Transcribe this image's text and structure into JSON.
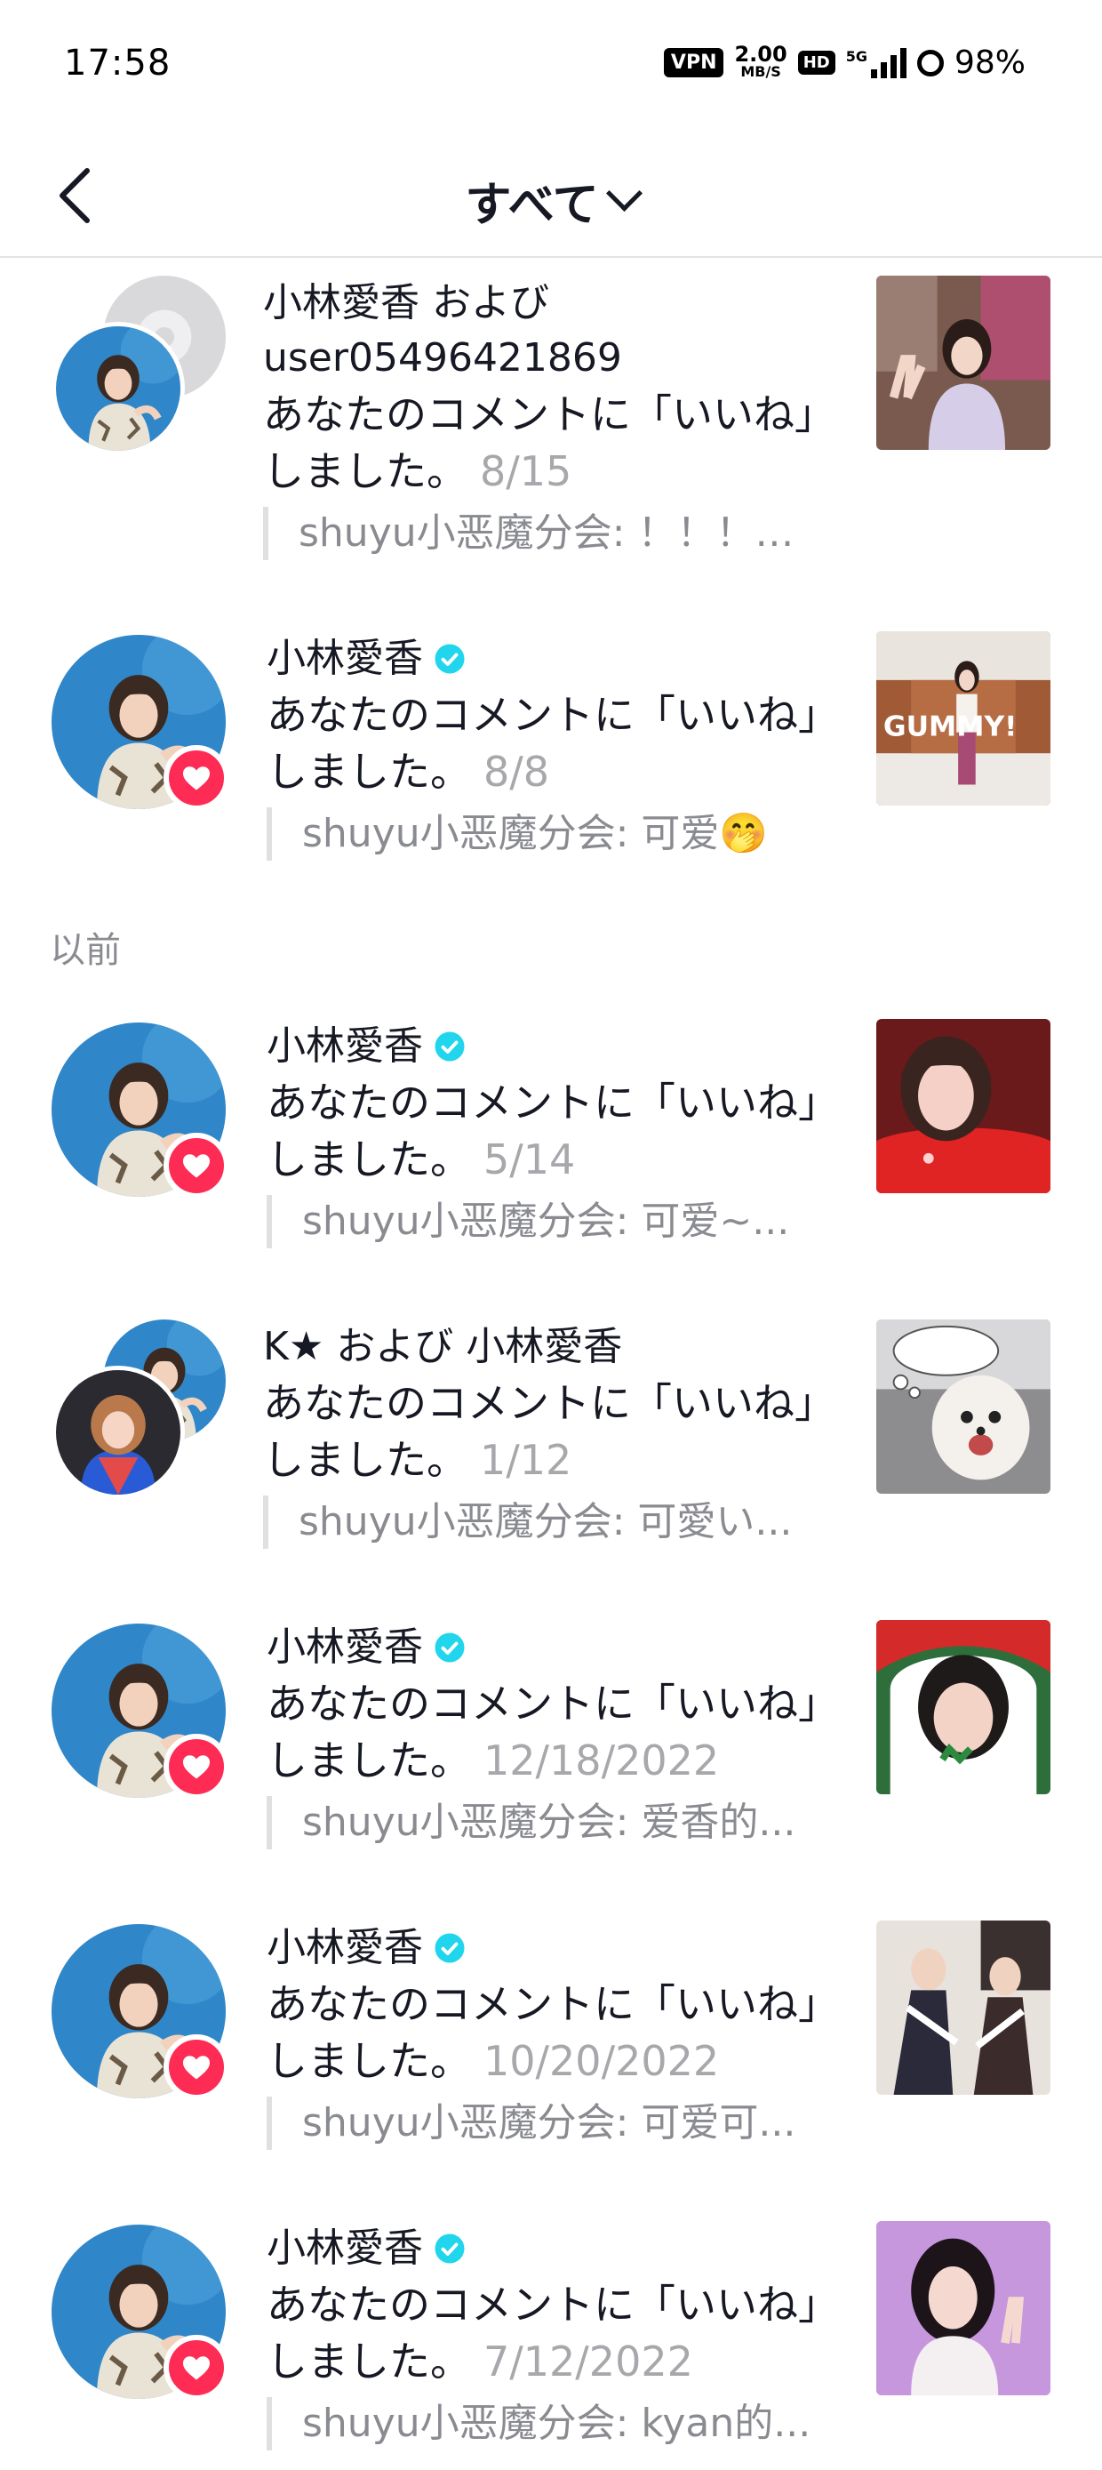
{
  "status_bar": {
    "time": "17:58",
    "vpn": "VPN",
    "speed_value": "2.00",
    "speed_unit": "MB/S",
    "hd": "HD",
    "network": "5G",
    "battery": "98%"
  },
  "header": {
    "title": "すべて"
  },
  "section_label": "以前",
  "notifications": [
    {
      "name_line1": "小林愛香 および",
      "name_line2": "user05496421869",
      "message": "あなたのコメントに「いいね」しました。",
      "date": "8/15",
      "comment": "shuyu小恶魔分会: ！！！…"
    },
    {
      "name": "小林愛香",
      "message": "あなたのコメントに「いいね」しました。",
      "date": "8/8",
      "comment": "shuyu小恶魔分会: 可爱🤭"
    },
    {
      "name": "小林愛香",
      "message": "あなたのコメントに「いいね」しました。",
      "date": "5/14",
      "comment": "shuyu小恶魔分会: 可爱~..."
    },
    {
      "name": "K★ および 小林愛香",
      "message": "あなたのコメントに「いいね」しました。",
      "date": "1/12",
      "comment": "shuyu小恶魔分会: 可愛い..."
    },
    {
      "name": "小林愛香",
      "message": "あなたのコメントに「いいね」しました。",
      "date": "12/18/2022",
      "comment": "shuyu小恶魔分会: 爱香的..."
    },
    {
      "name": "小林愛香",
      "message": "あなたのコメントに「いいね」しました。",
      "date": "10/20/2022",
      "comment": "shuyu小恶魔分会: 可爱可..."
    },
    {
      "name": "小林愛香",
      "message": "あなたのコメントに「いいね」しました。",
      "date": "7/12/2022",
      "comment": "shuyu小恶魔分会: kyan的..."
    }
  ],
  "thumb_texts": {
    "gummy": "GUMMY!"
  },
  "colors": {
    "heart": "#fe2c55",
    "verified": "#20d5ec",
    "avatar_bg": "#2f86c9"
  }
}
